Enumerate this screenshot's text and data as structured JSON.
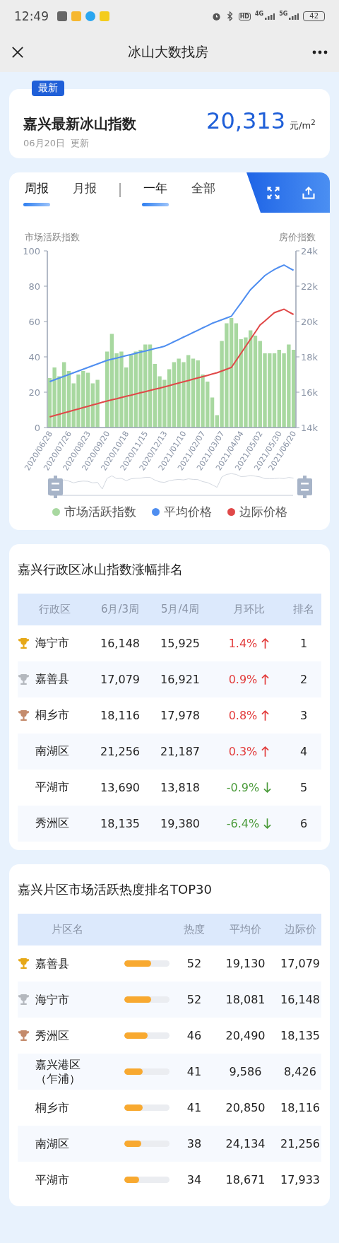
{
  "status_bar": {
    "time": "12:49",
    "hd_label": "HD",
    "networks": [
      "4G",
      "5G"
    ],
    "battery": "42"
  },
  "header": {
    "title": "冰山大数找房"
  },
  "summary": {
    "badge": "最新",
    "title": "嘉兴最新冰山指数",
    "value": "20,313",
    "unit": "元/m$^{2}$",
    "date": "06月20日",
    "update": "更新"
  },
  "tabs": {
    "period": [
      {
        "label": "周报",
        "selected": true
      },
      {
        "label": "月报",
        "selected": false
      }
    ],
    "range": [
      {
        "label": "一年",
        "selected": true
      },
      {
        "label": "全部",
        "selected": false
      }
    ]
  },
  "chart": {
    "left_axis_title": "市场活跃指数",
    "right_axis_title": "房价指数",
    "activity": {
      "chart_data": {
        "type": "bar",
        "categories": [
          "2020/06/28",
          null,
          null,
          null,
          "2020/07/26",
          null,
          null,
          null,
          "2020/08/23",
          null,
          null,
          null,
          "2020/09/20",
          null,
          null,
          null,
          "2020/10/18",
          null,
          null,
          null,
          "2020/11/15",
          null,
          null,
          null,
          "2020/12/13",
          null,
          null,
          null,
          "2021/01/10",
          null,
          null,
          null,
          "2021/02/07",
          null,
          null,
          null,
          "2021/03/07",
          null,
          null,
          null,
          "2021/04/04",
          null,
          null,
          null,
          "2021/05/02",
          null,
          null,
          null,
          "2021/05/30",
          null,
          null,
          "2021/06/20"
        ],
        "ylim": [
          0,
          100
        ],
        "yticks": [
          0,
          20,
          40,
          60,
          80,
          100
        ],
        "series": [
          {
            "name": "市场活跃指数",
            "color": "#a8d8a0",
            "values": [
              28,
              34,
              29,
              37,
              32,
              25,
              30,
              32,
              31,
              25,
              27,
              null,
              43,
              53,
              42,
              43,
              34,
              41,
              43,
              44,
              47,
              47,
              36,
              29,
              27,
              33,
              37,
              39,
              37,
              41,
              39,
              38,
              30,
              26,
              17,
              7,
              49,
              59,
              62,
              59,
              50,
              51,
              55,
              52,
              49,
              42,
              42,
              42,
              44,
              42,
              47,
              44
            ]
          }
        ]
      }
    },
    "prices": {
      "chart_data": {
        "type": "line",
        "categories": [
          null,
          null,
          null,
          null,
          null,
          null,
          null,
          null,
          null,
          null,
          null,
          null,
          null,
          null,
          null,
          null,
          null,
          null,
          null,
          null,
          null,
          null,
          null,
          null,
          null,
          null,
          null,
          null,
          null,
          null,
          null,
          null,
          null,
          null,
          null,
          null,
          null,
          null,
          null,
          null,
          null,
          null,
          null,
          null,
          null,
          null,
          null,
          null,
          null,
          null,
          null,
          null
        ],
        "ylim": [
          14000,
          24000
        ],
        "yticks": [
          {
            "value": 14000,
            "label": "14k"
          },
          {
            "value": 16000,
            "label": "16k"
          },
          {
            "value": 18000,
            "label": "18k"
          },
          {
            "value": 20000,
            "label": "20k"
          },
          {
            "value": 22000,
            "label": "22k"
          },
          {
            "value": 24000,
            "label": "24k"
          }
        ],
        "series": [
          {
            "name": "平均价格",
            "color": "#4f8ef0",
            "values": [
              16600,
              16700,
              16800,
              16900,
              17000,
              17100,
              17200,
              17300,
              17400,
              17500,
              17600,
              17700,
              17800,
              17870,
              17930,
              18000,
              18070,
              18130,
              18200,
              18270,
              18330,
              18400,
              18470,
              18530,
              18600,
              18730,
              18860,
              18990,
              19120,
              19250,
              19380,
              19510,
              19640,
              19770,
              19900,
              20000,
              20100,
              20200,
              20300,
              20680,
              21050,
              21430,
              21800,
              22070,
              22330,
              22600,
              22780,
              22950,
              23080,
              23200,
              23050,
              22900
            ]
          },
          {
            "name": "边际价格",
            "color": "#e04848",
            "values": [
              14600,
              14680,
              14750,
              14830,
              14900,
              14980,
              15050,
              15130,
              15200,
              15280,
              15350,
              15430,
              15500,
              15570,
              15630,
              15700,
              15770,
              15830,
              15900,
              15970,
              16030,
              16100,
              16170,
              16230,
              16300,
              16370,
              16450,
              16520,
              16590,
              16660,
              16740,
              16810,
              16880,
              16950,
              17030,
              17100,
              17200,
              17300,
              17400,
              17800,
              18200,
              18600,
              19000,
              19400,
              19800,
              20030,
              20270,
              20500,
              20600,
              20700,
              20550,
              20400
            ]
          }
        ]
      }
    }
  },
  "district_ranking": {
    "title": "嘉兴行政区冰山指数涨幅排名",
    "columns": [
      "行政区",
      "6月/3周",
      "5月/4周",
      "月环比",
      "排名"
    ],
    "rows": [
      {
        "color": "#e6a817",
        "name": "海宁市",
        "current": "16,148",
        "previous": "15,925",
        "change": "1.4%",
        "rising": true,
        "rank": "1"
      },
      {
        "color": "#b4b8be",
        "name": "嘉善县",
        "current": "17,079",
        "previous": "16,921",
        "change": "0.9%",
        "rising": true,
        "rank": "2"
      },
      {
        "color": "#c48b6c",
        "name": "桐乡市",
        "current": "18,116",
        "previous": "17,978",
        "change": "0.8%",
        "rising": true,
        "rank": "3"
      },
      {
        "name": "南湖区",
        "current": "21,256",
        "previous": "21,187",
        "change": "0.3%",
        "rising": true,
        "rank": "4"
      },
      {
        "name": "平湖市",
        "current": "13,690",
        "previous": "13,818",
        "change": "-0.9%",
        "rising": false,
        "rank": "5"
      },
      {
        "name": "秀洲区",
        "current": "18,135",
        "previous": "19,380",
        "change": "-6.4%",
        "rising": false,
        "rank": "6"
      }
    ]
  },
  "area_ranking": {
    "title": "嘉兴片区市场活跃热度排名TOP30",
    "columns": [
      "片区名",
      "热度",
      "平均价",
      "边际价"
    ],
    "rows": [
      {
        "color": "#e6a817",
        "name": "嘉善县",
        "level": 0.6,
        "heat": "52",
        "average": "19,130",
        "marginal": "17,079"
      },
      {
        "color": "#b4b8be",
        "name": "海宁市",
        "level": 0.6,
        "heat": "52",
        "average": "18,081",
        "marginal": "16,148"
      },
      {
        "color": "#c48b6c",
        "name": "秀洲区",
        "level": 0.53,
        "heat": "46",
        "average": "20,490",
        "marginal": "18,135"
      },
      {
        "name": "嘉兴港区（乍浦）",
        "level": 0.41,
        "heat": "41",
        "average": "9,586",
        "marginal": "8,426"
      },
      {
        "name": "桐乡市",
        "level": 0.41,
        "heat": "41",
        "average": "20,850",
        "marginal": "18,116"
      },
      {
        "name": "南湖区",
        "level": 0.39,
        "heat": "38",
        "average": "24,134",
        "marginal": "21,256"
      },
      {
        "name": "平湖市",
        "level": 0.34,
        "heat": "34",
        "average": "18,671",
        "marginal": "17,933"
      }
    ]
  }
}
